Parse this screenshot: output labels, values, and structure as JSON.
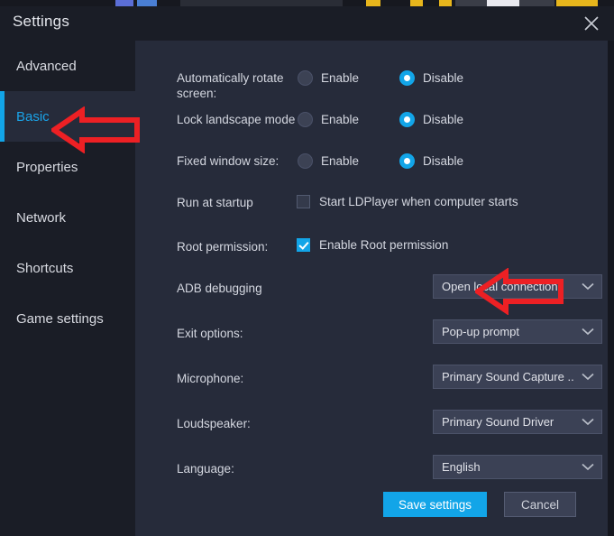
{
  "window": {
    "title": "Settings",
    "close_icon": "close-icon"
  },
  "sidebar": {
    "items": [
      {
        "label": "Advanced",
        "selected": false
      },
      {
        "label": "Basic",
        "selected": true
      },
      {
        "label": "Properties",
        "selected": false
      },
      {
        "label": "Network",
        "selected": false
      },
      {
        "label": "Shortcuts",
        "selected": false
      },
      {
        "label": "Game settings",
        "selected": false
      }
    ]
  },
  "settings": {
    "auto_rotate": {
      "label": "Automatically rotate screen:",
      "enable_label": "Enable",
      "disable_label": "Disable",
      "value": "Disable"
    },
    "lock_landscape": {
      "label": "Lock landscape mode",
      "enable_label": "Enable",
      "disable_label": "Disable",
      "value": "Disable"
    },
    "fixed_window": {
      "label": "Fixed window size:",
      "enable_label": "Enable",
      "disable_label": "Disable",
      "value": "Disable"
    },
    "run_at_startup": {
      "label": "Run at startup",
      "checkbox_label": "Start LDPlayer when computer starts",
      "checked": false
    },
    "root_permission": {
      "label": "Root permission:",
      "checkbox_label": "Enable Root permission",
      "checked": true
    },
    "adb_debugging": {
      "label": "ADB debugging",
      "value": "Open local connection"
    },
    "exit_options": {
      "label": "Exit options:",
      "value": "Pop-up prompt"
    },
    "microphone": {
      "label": "Microphone:",
      "value": "Primary Sound Capture ..."
    },
    "loudspeaker": {
      "label": "Loudspeaker:",
      "value": "Primary Sound Driver"
    },
    "language": {
      "label": "Language:",
      "value": "English"
    }
  },
  "footer": {
    "save_label": "Save settings",
    "cancel_label": "Cancel"
  },
  "annotations": {
    "arrow_color": "#ed2024",
    "arrow_basic": "left-arrow-pointing-at-basic-tab",
    "arrow_adb": "left-arrow-pointing-at-adb-dropdown"
  },
  "colors": {
    "accent": "#12a5e8",
    "sidebar_bg": "#1a1d26",
    "content_bg": "#262b3a",
    "select_bg": "#3b4155"
  }
}
